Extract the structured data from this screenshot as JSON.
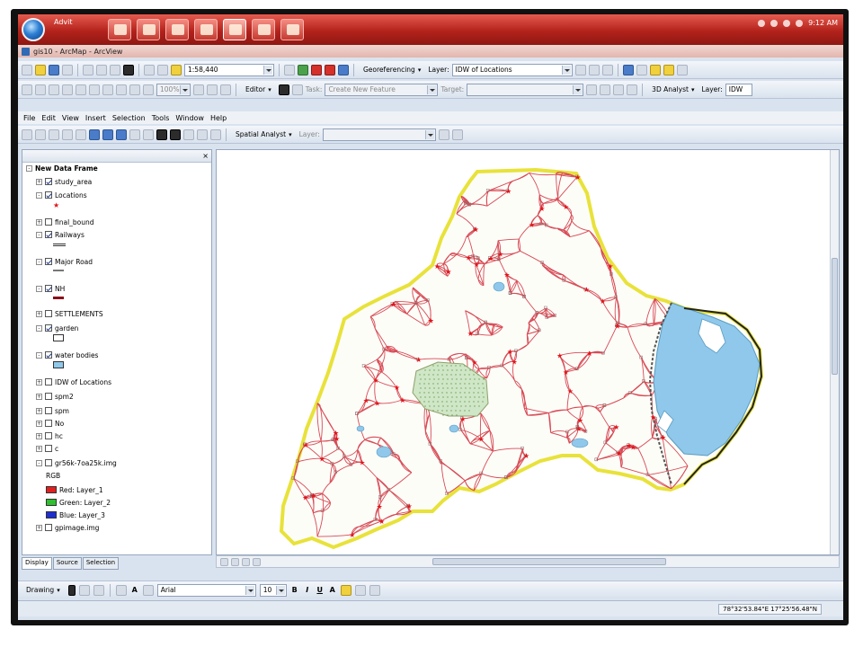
{
  "taskbar": {
    "search_text": "Advit",
    "clock": "9:12 AM",
    "apps": [
      "explorer-icon",
      "media-icon",
      "office-icon",
      "search-app-icon",
      "globe-icon",
      "word-icon",
      "paint-icon"
    ]
  },
  "window": {
    "title": "gis10 - ArcMap - ArcView"
  },
  "standard_toolbar": {
    "scale": "1:58,440",
    "georeferencing_label": "Georeferencing",
    "layer_label": "Layer:",
    "layer_value": "IDW of Locations"
  },
  "editor_toolbar": {
    "zoom_value": "100%",
    "editor_label": "Editor",
    "task_label": "Task:",
    "task_value": "Create New Feature",
    "target_label": "Target:",
    "target_value": "",
    "analyst_3d": "3D Analyst",
    "layer_label": "Layer:",
    "layer_value": "IDW"
  },
  "menu": [
    "File",
    "Edit",
    "View",
    "Insert",
    "Selection",
    "Tools",
    "Window",
    "Help"
  ],
  "tools_toolbar": {
    "spatial_analyst": "Spatial Analyst",
    "layer_label": "Layer:",
    "layer_value": ""
  },
  "toc": {
    "close": "×",
    "tabs": [
      "Display",
      "Source",
      "Selection"
    ],
    "rows": [
      {
        "text": "New Data Frame",
        "expand": "-",
        "checked": null,
        "bold": true,
        "indent": 0
      },
      {
        "text": "study_area",
        "expand": "+",
        "checked": true,
        "indent": 1
      },
      {
        "text": "Locations",
        "expand": "-",
        "checked": true,
        "indent": 1
      },
      {
        "text": "final_bound",
        "expand": "+",
        "checked": false,
        "indent": 1
      },
      {
        "text": "Railways",
        "expand": "-",
        "checked": true,
        "indent": 1
      },
      {
        "text": "Major Road",
        "expand": "-",
        "checked": true,
        "indent": 1
      },
      {
        "text": "NH",
        "expand": "-",
        "checked": true,
        "indent": 1
      },
      {
        "text": "SETTLEMENTS",
        "expand": "+",
        "checked": false,
        "indent": 1
      },
      {
        "text": "garden",
        "expand": "-",
        "checked": true,
        "indent": 1
      },
      {
        "text": "water bodies",
        "expand": "-",
        "checked": true,
        "indent": 1
      },
      {
        "text": "IDW of Locations",
        "expand": "+",
        "checked": false,
        "indent": 1
      },
      {
        "text": "spm2",
        "expand": "+",
        "checked": false,
        "indent": 1
      },
      {
        "text": "spm",
        "expand": "+",
        "checked": false,
        "indent": 1
      },
      {
        "text": "No",
        "expand": "+",
        "checked": false,
        "indent": 1
      },
      {
        "text": "hc",
        "expand": "+",
        "checked": false,
        "indent": 1
      },
      {
        "text": "c",
        "expand": "+",
        "checked": false,
        "indent": 1
      },
      {
        "text": "gr56k-7oa25k.img",
        "expand": "-",
        "checked": false,
        "indent": 1
      },
      {
        "text": "RGB",
        "expand": "",
        "checked": null,
        "indent": 2
      },
      {
        "text": "Red:  Layer_1",
        "expand": "",
        "checked": null,
        "indent": 2,
        "swatch": "#e02020"
      },
      {
        "text": "Green: Layer_2",
        "expand": "",
        "checked": null,
        "indent": 2,
        "swatch": "#2fbf2f"
      },
      {
        "text": "Blue:  Layer_3",
        "expand": "",
        "checked": null,
        "indent": 2,
        "swatch": "#1f2fcf"
      },
      {
        "text": "gpimage.img",
        "expand": "+",
        "checked": false,
        "indent": 1
      }
    ]
  },
  "drawing_toolbar": {
    "drawing_label": "Drawing",
    "font": "Arial",
    "size": "10",
    "bold": "B",
    "italic": "I",
    "underline": "U",
    "font_color": "A"
  },
  "status": {
    "coords": "78°32'53.84\"E  17°25'56.48\"N"
  },
  "colors": {
    "roads": "#d84a55",
    "boundary": "#e8e23a",
    "water": "#8fc8ea",
    "garden": "#cfe7c6",
    "locations": "#e1141b"
  }
}
